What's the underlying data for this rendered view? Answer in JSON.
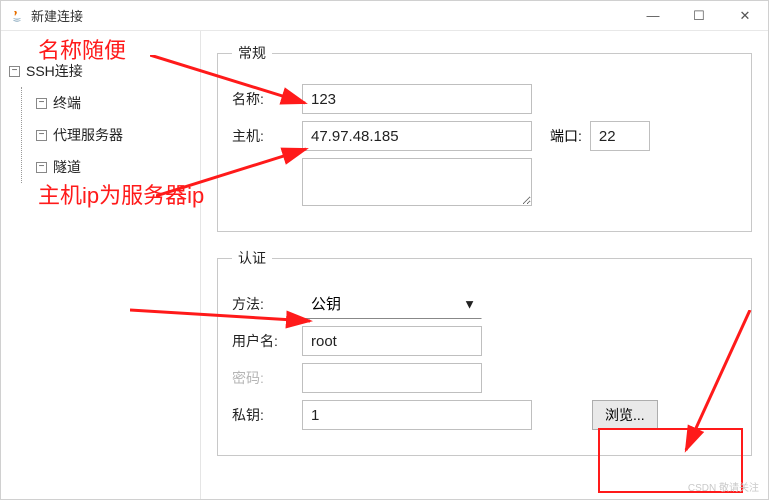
{
  "window": {
    "title": "新建连接",
    "btn_min": "—",
    "btn_max": "☐",
    "btn_close": "✕"
  },
  "tree": {
    "root": "SSH连接",
    "nodes": [
      "终端",
      "代理服务器",
      "隧道"
    ]
  },
  "general": {
    "legend": "常规",
    "name_label": "名称:",
    "name_value": "123",
    "host_label": "主机:",
    "host_value": "47.97.48.185",
    "port_label": "端口:",
    "port_value": "22"
  },
  "auth": {
    "legend": "认证",
    "method_label": "方法:",
    "method_value": "公钥",
    "user_label": "用户名:",
    "user_value": "root",
    "pass_label": "密码:",
    "pass_value": "",
    "key_label": "私钥:",
    "key_value": "1",
    "browse": "浏览..."
  },
  "annotations": {
    "a1": "名称随便",
    "a2": "主机ip为服务器ip"
  },
  "watermark": "CSDN 敬请关注"
}
